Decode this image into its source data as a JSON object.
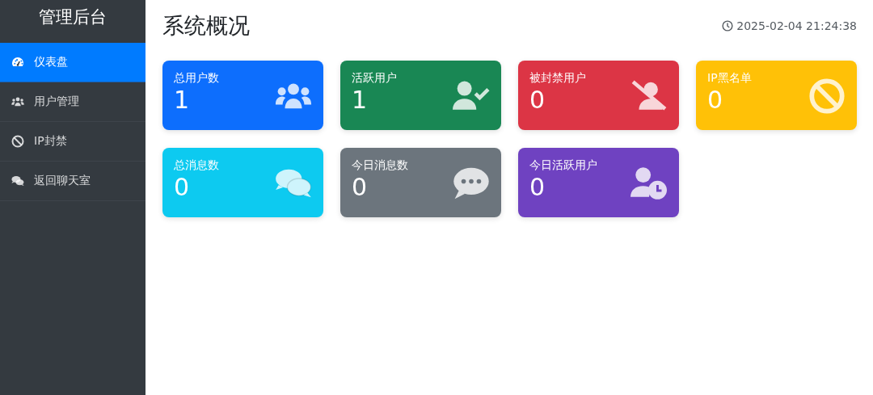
{
  "sidebar": {
    "title": "管理后台",
    "items": [
      {
        "label": "仪表盘",
        "selected": true
      },
      {
        "label": "用户管理",
        "selected": false
      },
      {
        "label": "IP封禁",
        "selected": false
      },
      {
        "label": "返回聊天室",
        "selected": false
      }
    ]
  },
  "header": {
    "title": "系统概况",
    "timestamp": "2025-02-04 21:24:38"
  },
  "cards": [
    {
      "label": "总用户数",
      "value": "1",
      "color": "#0d6efd"
    },
    {
      "label": "活跃用户",
      "value": "1",
      "color": "#198754"
    },
    {
      "label": "被封禁用户",
      "value": "0",
      "color": "#dc3545"
    },
    {
      "label": "IP黑名单",
      "value": "0",
      "color": "#ffc107"
    },
    {
      "label": "总消息数",
      "value": "0",
      "color": "#0dcaf0"
    },
    {
      "label": "今日消息数",
      "value": "0",
      "color": "#6c757d"
    },
    {
      "label": "今日活跃用户",
      "value": "0",
      "color": "#6f42c1"
    }
  ]
}
